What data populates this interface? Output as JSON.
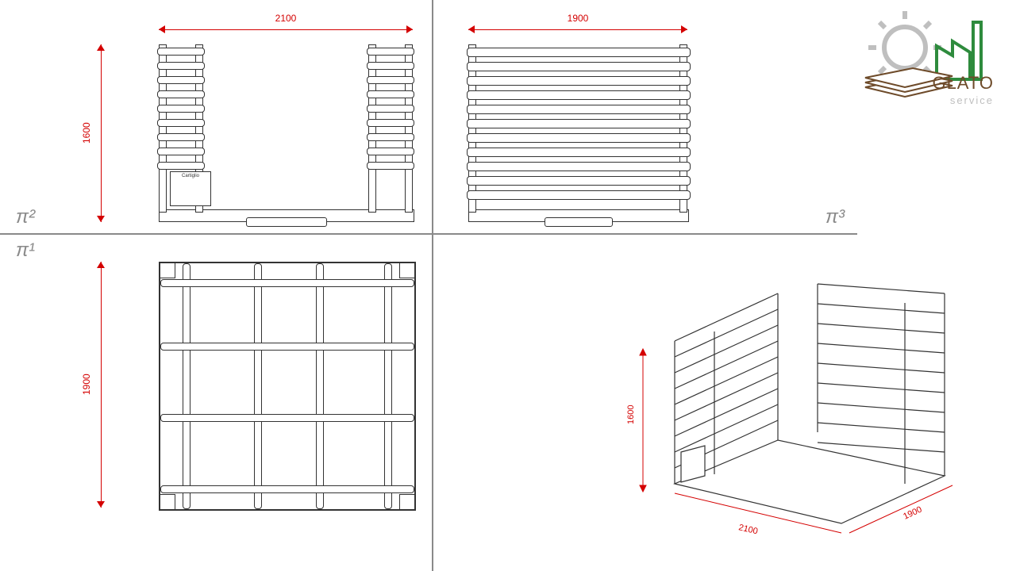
{
  "views": {
    "pi1": "π¹",
    "pi2": "π²",
    "pi3": "π³"
  },
  "dimensions": {
    "front_width": "2100",
    "front_height": "1600",
    "side_width": "1900",
    "top_depth": "1900",
    "iso_width": "2100",
    "iso_height": "1600",
    "iso_depth": "1900"
  },
  "labels": {
    "plate": "Cartiglio"
  },
  "logo": {
    "name": "GLATO",
    "sub": "service"
  }
}
